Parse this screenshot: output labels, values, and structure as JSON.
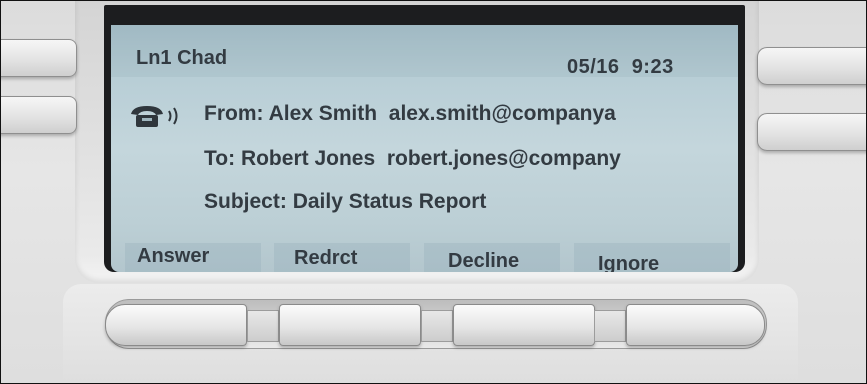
{
  "header": {
    "line_label": "Ln1 Chad",
    "date": "05/16",
    "time": "9:23"
  },
  "call": {
    "icon": "phone-ringing-icon",
    "from_label": "From:",
    "from_name": "Alex Smith",
    "from_email": "alex.smith@companya",
    "to_label": "To:",
    "to_name": "Robert Jones",
    "to_email": "robert.jones@company",
    "subject_label": "Subject:",
    "subject": "Daily Status Report"
  },
  "softkeys": [
    "Answer",
    "Redrct",
    "Decline",
    "Ignore"
  ],
  "colors": {
    "lcd_background": "#bccfd5",
    "lcd_text": "#333b42",
    "bezel": "#1c1d1f"
  }
}
